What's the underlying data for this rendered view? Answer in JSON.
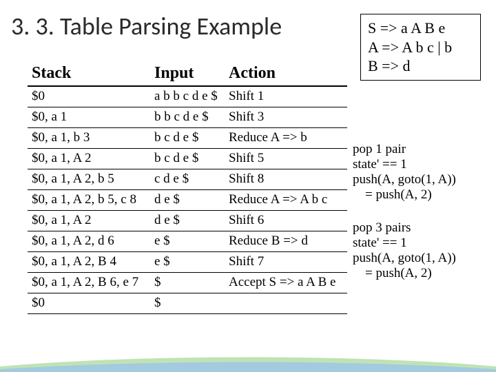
{
  "title": "3. 3. Table Parsing Example",
  "grammar": {
    "line1": "S => a A B e",
    "line2": "A => A b c | b",
    "line3": "B => d"
  },
  "headers": {
    "stack": "Stack",
    "input": "Input",
    "action": "Action"
  },
  "rows": [
    {
      "stack": "$0",
      "input": "a b b c d e $",
      "action": "Shift 1"
    },
    {
      "stack": "$0, a 1",
      "input": "b b c d e $",
      "action": "Shift 3"
    },
    {
      "stack": "$0, a 1, b 3",
      "input": "b c d e $",
      "action": "Reduce A => b"
    },
    {
      "stack": "$0, a 1, A 2",
      "input": "b c d e $",
      "action": "Shift 5"
    },
    {
      "stack": "$0, a 1, A 2, b 5",
      "input": "c d e $",
      "action": "Shift 8"
    },
    {
      "stack": "$0, a 1, A 2, b 5, c 8",
      "input": "d e $",
      "action": "Reduce A => A b c"
    },
    {
      "stack": "$0, a 1, A 2",
      "input": "d e $",
      "action": "Shift 6"
    },
    {
      "stack": "$0, a 1, A 2, d 6",
      "input": "e $",
      "action": "Reduce B => d"
    },
    {
      "stack": "$0, a 1, A 2, B 4",
      "input": "e $",
      "action": "Shift 7"
    },
    {
      "stack": "$0, a 1, A 2, B 6, e 7",
      "input": "$",
      "action": "Accept S => a A B e"
    },
    {
      "stack": "$0",
      "input": "$",
      "action": ""
    }
  ],
  "note1": {
    "l1": "pop 1 pair",
    "l2": "state' == 1",
    "l3": "push(A, goto(1, A))",
    "l4": "= push(A, 2)"
  },
  "note2": {
    "l1": "pop 3 pairs",
    "l2": "state' == 1",
    "l3": "push(A, goto(1, A))",
    "l4": "= push(A, 2)"
  }
}
